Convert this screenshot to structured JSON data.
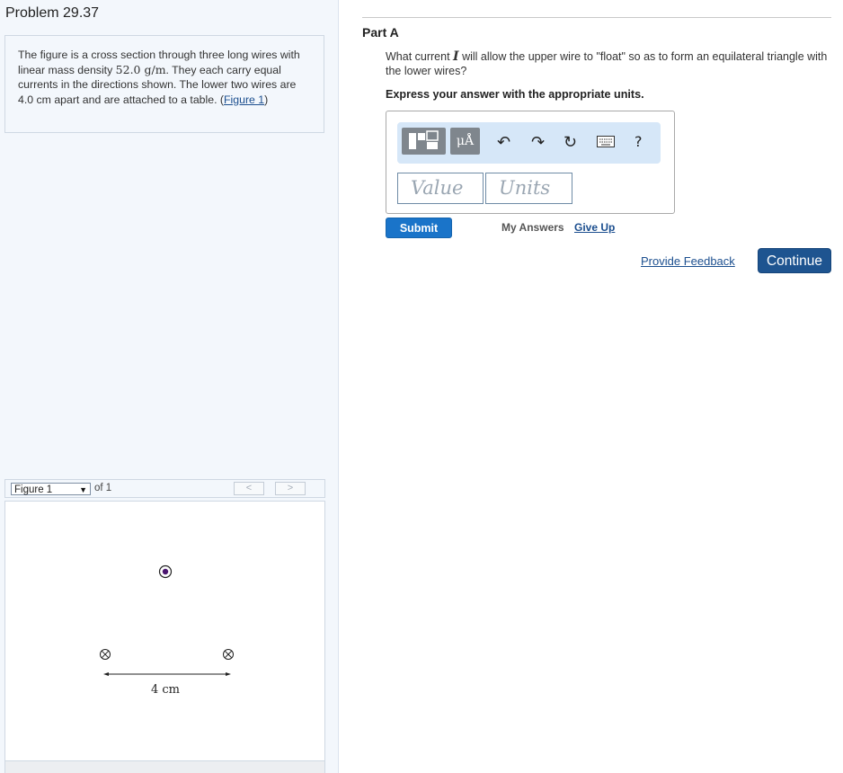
{
  "problem": {
    "title": "Problem 29.37"
  },
  "intro": {
    "text_1": "The figure is a cross section through three long wires with linear mass density ",
    "mass_density": "52.0  g/m",
    "text_2": ". They each carry equal currents in the directions shown. The lower two wires are 4.0 cm apart and are attached to a table.",
    "figure_link_open": "(",
    "figure_link": "Figure 1",
    "figure_link_close": ")"
  },
  "figure_nav": {
    "selected": "Figure 1",
    "of_label": "of 1",
    "prev_icon": "chevron-left",
    "next_icon": "chevron-right"
  },
  "figure": {
    "distance_label": "4 cm",
    "wires": [
      {
        "direction": "out-of-page",
        "symbol": "dot"
      },
      {
        "direction": "into-page",
        "symbol": "cross"
      },
      {
        "direction": "into-page",
        "symbol": "cross"
      }
    ]
  },
  "part": {
    "title": "Part A",
    "question_1": "What current ",
    "question_var": "I",
    "question_2": " will allow the upper wire to \"float\" so as to form an equilateral triangle with the lower wires?",
    "instruction": "Express your answer with the appropriate units."
  },
  "toolbar": {
    "units_label": "μÅ",
    "help_label": "?",
    "icons": [
      "templates-icon",
      "units-icon",
      "undo-icon",
      "redo-icon",
      "reset-icon",
      "keyboard-icon",
      "help-icon"
    ]
  },
  "answer": {
    "value_placeholder": "Value",
    "units_placeholder": "Units"
  },
  "actions": {
    "submit": "Submit",
    "my_answers": "My Answers",
    "give_up": "Give Up",
    "feedback": "Provide Feedback",
    "continue": "Continue"
  },
  "colors": {
    "accent": "#1a74c9",
    "continue": "#1e5490",
    "link": "#1c4f8f",
    "wire_dot": "#4b1670"
  }
}
